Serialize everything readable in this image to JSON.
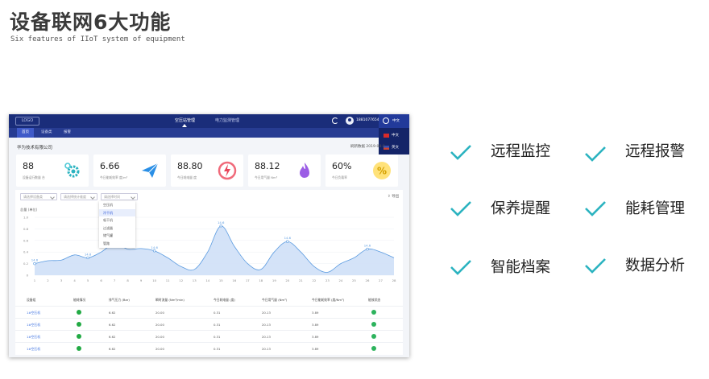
{
  "page": {
    "title": "设备联网6大功能",
    "subtitle": "Six features of IIoT system of equipment"
  },
  "app": {
    "logo": "LOGO",
    "nav": {
      "air": "空压站管理",
      "power": "电力监测管理"
    },
    "user": {
      "phone": "18810776546",
      "lang": "中文"
    },
    "lang_menu": [
      {
        "label": "中文"
      },
      {
        "label": "英文"
      }
    ],
    "tabs": [
      "首页",
      "设备类",
      "报警"
    ],
    "company": "华为技术有限公司",
    "datetime": "刷新数据  2019-08-0",
    "kpis": [
      {
        "value": "88",
        "label": "设备运行数量 台",
        "icon": "gear-icon"
      },
      {
        "value": "6.66",
        "label": "今日能耗效率 度/m³",
        "icon": "paper-plane-icon"
      },
      {
        "value": "88.80",
        "label": "今日耗电量 度",
        "icon": "lightning-icon"
      },
      {
        "value": "88.12",
        "label": "今日用气量 Nm³",
        "icon": "flame-icon"
      },
      {
        "value": "60%",
        "label": "今日负载率",
        "icon": "percent-icon"
      }
    ],
    "filters": {
      "f1": "请选择设备类",
      "f2": "请选择统计维度",
      "f3": "请选择时间",
      "export": "导出"
    },
    "dropdown": [
      "空压机",
      "冷干机",
      "吸干机",
      "过滤器",
      "储气罐",
      "管路"
    ],
    "chart_unit": "总量 (单位)",
    "table": {
      "headers": [
        "设备组",
        "能耗情况",
        "排气压力 (Bar)",
        "瞬时流量 (Nm³/min)",
        "今日耗电量 (度)",
        "今日用气量 (Nm³)",
        "今日能耗效率 (度/Nm³)",
        "能效状态"
      ],
      "rows": [
        [
          "1#空压机",
          "",
          "6.62",
          "20.00",
          "0.31",
          "20.13",
          "3.89"
        ],
        [
          "1#空压机",
          "",
          "6.62",
          "20.00",
          "0.31",
          "20.13",
          "3.89"
        ],
        [
          "1#空压机",
          "",
          "6.62",
          "20.00",
          "0.31",
          "20.13",
          "3.89"
        ],
        [
          "1#空压机",
          "",
          "6.62",
          "20.00",
          "0.31",
          "20.13",
          "3.89"
        ]
      ]
    }
  },
  "features": [
    "远程监控",
    "远程报警",
    "保养提醒",
    "能耗管理",
    "智能档案",
    "数据分析"
  ],
  "colors": {
    "nav": "#1a2d7a",
    "accent": "#2bb3c0",
    "area": "#cfe0f7"
  },
  "chart_data": {
    "type": "area",
    "x": [
      1,
      2,
      3,
      4,
      5,
      6,
      7,
      8,
      9,
      10,
      11,
      12,
      13,
      14,
      15,
      16,
      17,
      18,
      19,
      20,
      21,
      22,
      23,
      24,
      25,
      26,
      27,
      28
    ],
    "y": [
      0.2,
      0.25,
      0.26,
      0.35,
      0.3,
      0.4,
      0.55,
      0.45,
      0.46,
      0.42,
      0.3,
      0.15,
      0.1,
      0.4,
      0.85,
      0.5,
      0.2,
      0.1,
      0.4,
      0.58,
      0.4,
      0.15,
      0.05,
      0.2,
      0.3,
      0.45,
      0.4,
      0.3
    ],
    "ylim": [
      0,
      1.0
    ],
    "yticks": [
      "0",
      "0.2",
      "0.4",
      "0.6",
      "0.8",
      "1.0"
    ],
    "point_labels": [
      {
        "x": 1,
        "label": "14.6"
      },
      {
        "x": 5,
        "label": "14.6"
      },
      {
        "x": 10,
        "label": "14.6"
      },
      {
        "x": 15,
        "label": "14.6"
      },
      {
        "x": 20,
        "label": "14.6"
      },
      {
        "x": 26,
        "label": "14.6"
      }
    ]
  }
}
